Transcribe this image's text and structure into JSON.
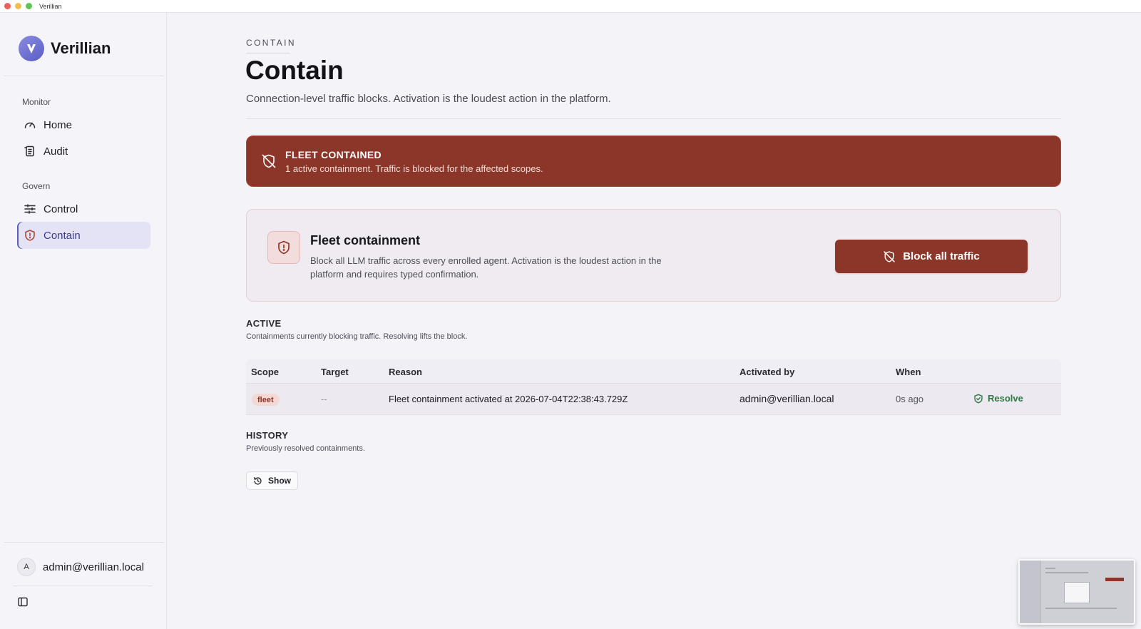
{
  "window": {
    "title": "Verillian"
  },
  "brand": {
    "name": "Verillian"
  },
  "sidebar": {
    "sections": [
      {
        "label": "Monitor",
        "items": [
          {
            "label": "Home",
            "icon": "gauge-icon"
          },
          {
            "label": "Audit",
            "icon": "scroll-icon"
          }
        ]
      },
      {
        "label": "Govern",
        "items": [
          {
            "label": "Control",
            "icon": "sliders-icon"
          },
          {
            "label": "Contain",
            "icon": "shield-alert-icon",
            "active": true
          }
        ]
      }
    ],
    "user": {
      "initial": "A",
      "email": "admin@verillian.local"
    }
  },
  "page": {
    "eyebrow": "CONTAIN",
    "title": "Contain",
    "subtitle": "Connection-level traffic blocks. Activation is the loudest action in the platform."
  },
  "banner": {
    "title": "FLEET CONTAINED",
    "subtitle": "1 active containment. Traffic is blocked for the affected scopes.",
    "color": "#8b3628"
  },
  "fleet_card": {
    "title": "Fleet containment",
    "description": "Block all LLM traffic across every enrolled agent. Activation is the loudest action in the platform and requires typed confirmation.",
    "button_label": "Block all traffic"
  },
  "active": {
    "title": "ACTIVE",
    "subtitle": "Containments currently blocking traffic. Resolving lifts the block.",
    "columns": {
      "scope": "Scope",
      "target": "Target",
      "reason": "Reason",
      "activated_by": "Activated by",
      "when": "When"
    },
    "rows": [
      {
        "scope": "fleet",
        "target": "--",
        "reason": "Fleet containment activated at 2026-07-04T22:38:43.729Z",
        "activated_by": "admin@verillian.local",
        "when": "0s ago",
        "action": "Resolve"
      }
    ]
  },
  "history": {
    "title": "HISTORY",
    "subtitle": "Previously resolved containments.",
    "button_label": "Show"
  }
}
